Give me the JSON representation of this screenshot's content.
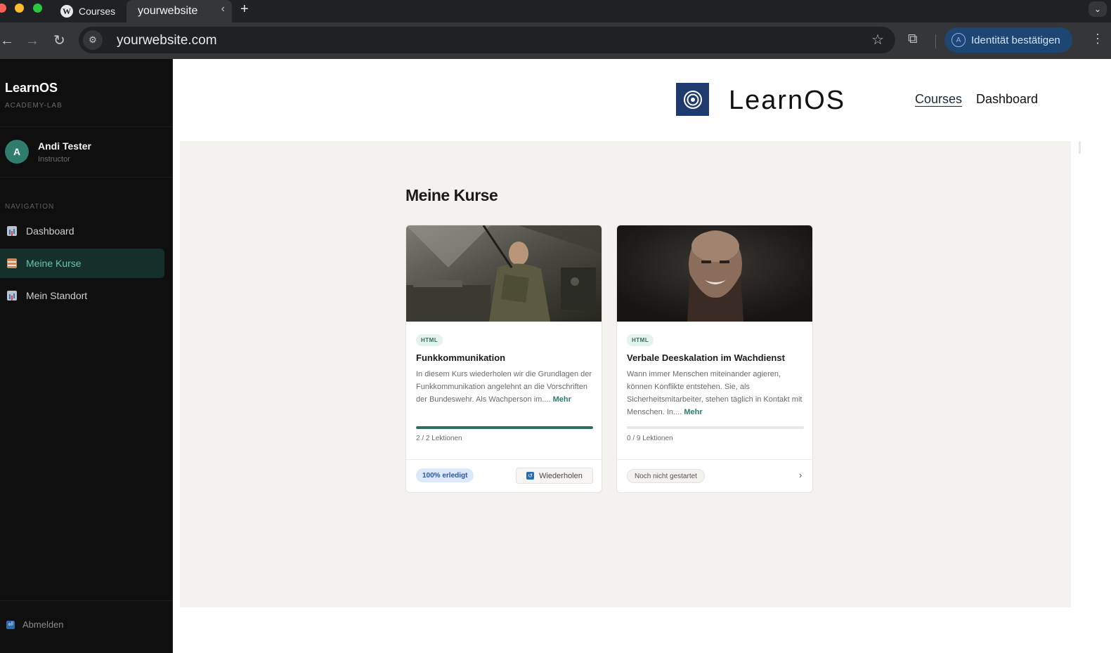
{
  "browser": {
    "tabs": [
      {
        "label": "Courses"
      },
      {
        "label": "yourwebsite"
      }
    ],
    "url": "yourwebsite.com",
    "identity_button": "Identität bestätigen",
    "identity_avatar": "A"
  },
  "sidebar": {
    "brand": "LearnOS",
    "brand_sub": "ACADEMY-LAB",
    "user": {
      "initial": "A",
      "name": "Andi Tester",
      "role": "Instructor"
    },
    "nav_heading": "NAVIGATION",
    "items": [
      {
        "label": "Dashboard",
        "icon": "chart-icon",
        "active": false
      },
      {
        "label": "Meine Kurse",
        "icon": "books-icon",
        "active": true
      },
      {
        "label": "Mein Standort",
        "icon": "chart-icon",
        "active": false
      }
    ],
    "logout": "Abmelden"
  },
  "site": {
    "name": "LearnOS",
    "nav": [
      {
        "label": "Courses",
        "current": true
      },
      {
        "label": "Dashboard",
        "current": false
      }
    ],
    "brand_color": "#1e3a6e"
  },
  "main": {
    "title": "Meine Kurse",
    "courses": [
      {
        "type": "HTML",
        "title": "Funkkommunikation",
        "description": "In diesem Kurs wiederholen wir die Grundlagen der Funkkommunikation angelehnt an die Vorschriften der Bundeswehr. Als Wachperson im....",
        "more": "Mehr",
        "progress": 1.0,
        "lessons": "2 / 2 Lektionen",
        "status": "100% erledigt",
        "action": "Wiederholen"
      },
      {
        "type": "HTML",
        "title": "Verbale Deeskalation im Wachdienst",
        "description": "Wann immer Menschen miteinander agieren, können Konflikte entstehen. Sie, als Sicherheitsmitarbeiter, stehen täglich in Kontakt mit Menschen. In....",
        "more": "Mehr",
        "progress": 0.0,
        "lessons": "0 / 9 Lektionen",
        "status": "Noch nicht gestartet",
        "action": "›"
      }
    ],
    "accent_color": "#2f6d5f"
  }
}
